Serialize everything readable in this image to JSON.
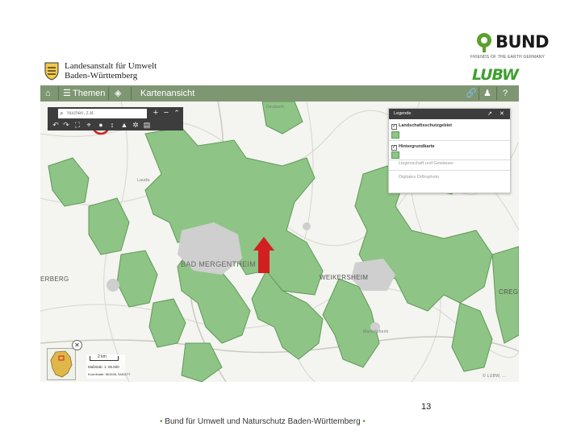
{
  "bund": {
    "name": "BUND",
    "tagline": "FRIENDS OF THE EARTH GERMANY"
  },
  "lubw": {
    "name_line1": "Landesanstalt für Umwelt",
    "name_line2": "Baden-Württemberg",
    "logo": "LUBW"
  },
  "toolbar": {
    "home_icon": "home-icon",
    "themes_label": "Themen",
    "map_view_label": "Kartenansicht",
    "right_icons": [
      "link-icon",
      "share-icon",
      "user-icon",
      "help-icon"
    ]
  },
  "search": {
    "placeholder": "Suchen, z.B.",
    "value": ""
  },
  "map_tools": [
    "back-icon",
    "forward-icon",
    "fullscreen-icon",
    "locate-icon",
    "circle-select-icon",
    "measure-icon",
    "settings-icon",
    "print-icon",
    "zoom-in-icon",
    "zoom-out-icon",
    "collapse-icon"
  ],
  "legend": {
    "title": "Legende",
    "items": [
      {
        "label": "Landschaftsschutzgebiet",
        "checked": true,
        "active": true
      },
      {
        "label": "Hintergrundkarte",
        "checked": true,
        "active": true
      },
      {
        "label": "Liegenschaft und Gewässer",
        "checked": false,
        "active": false
      },
      {
        "label": "Digitales Orthophoto",
        "checked": false,
        "active": false
      }
    ]
  },
  "towns": {
    "bad_mergentheim": "BAD MERGENTHEIM",
    "weikersheim": "WEIKERSHEIM",
    "left_town": "ERBERG",
    "right_town": "CREGL",
    "deubach": "Deubach",
    "lauda": "Lauda",
    "markelsheim": "Markelsheim"
  },
  "scale": {
    "bar_label": "2 km",
    "scale_text": "Maßstab: 1: 55.500",
    "coords_text": "Koordinate: 561548, 5481177"
  },
  "attribution": "© LUBW, ...",
  "annotations": {
    "highlight_color": "#d21f1f",
    "arrow_color": "#d21f1f"
  },
  "colors": {
    "protected_area": "#8ec485",
    "toolbar": "#7e9672"
  },
  "page": {
    "number": "13",
    "footer": "Bund für Umwelt und Naturschutz  Baden-Württemberg"
  }
}
